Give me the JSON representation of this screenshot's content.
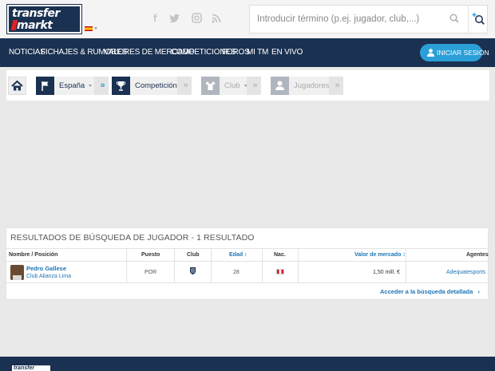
{
  "header": {
    "logo_line1": "transfer",
    "logo_line2": "markt",
    "social_icons": [
      "facebook-icon",
      "twitter-icon",
      "instagram-icon",
      "rss-icon"
    ],
    "search_placeholder": "Introducir término (p.ej. jugador, club,...)"
  },
  "nav": {
    "items": [
      "NOTICIAS",
      "FICHAJES & RUMORES",
      "VALORES DE MERCADO",
      "COMPETICIONES",
      "FOROS",
      "MI TM",
      "EN VIVO"
    ],
    "login_label": "INICIAR SESIÓN"
  },
  "breadcrumbs": {
    "country": "España",
    "competition": "Competición",
    "club": "Club",
    "players": "Jugadores"
  },
  "results": {
    "title": "RESULTADOS DE BÚSQUEDA DE JUGADOR - 1 RESULTADO",
    "columns": {
      "name": "Nombre / Posición",
      "position": "Puesto",
      "club": "Club",
      "age": "Edad",
      "nationality": "Nac.",
      "market_value": "Valor de mercado",
      "agents": "Agentes"
    },
    "rows": [
      {
        "name": "Pedro Gallese",
        "club": "Club Alianza Lima",
        "position": "POR",
        "age": "28",
        "market_value": "1,50 mill. €",
        "agent": "Adequatesports"
      }
    ],
    "more_link": "Acceder a la búsqueda detallada"
  },
  "footer": {
    "logo": "transfer"
  },
  "colors": {
    "navy": "#1a3151",
    "accent_blue": "#2a9fd8",
    "link_blue": "#1d75b3"
  }
}
